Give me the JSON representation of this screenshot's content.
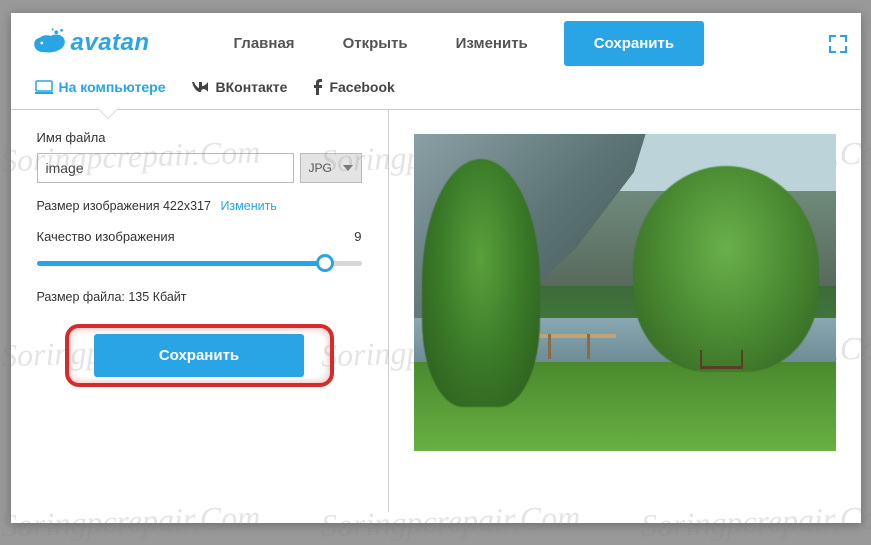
{
  "brand": "avatan",
  "nav": {
    "home": "Главная",
    "open": "Открыть",
    "edit": "Изменить",
    "save": "Сохранить"
  },
  "tabs": {
    "computer": "На компьютере",
    "vk": "ВКонтакте",
    "facebook": "Facebook"
  },
  "panel": {
    "filename_label": "Имя файла",
    "filename_value": "image",
    "format": "JPG",
    "image_size_label": "Размер изображения",
    "image_size_value": "422x317",
    "change_link": "Изменить",
    "quality_label": "Качество изображения",
    "quality_value": "9",
    "file_size_label": "Размер файла:",
    "file_size_value": "135 Кбайт",
    "save_button": "Сохранить"
  },
  "watermark": "Soringpcrepair.Com"
}
